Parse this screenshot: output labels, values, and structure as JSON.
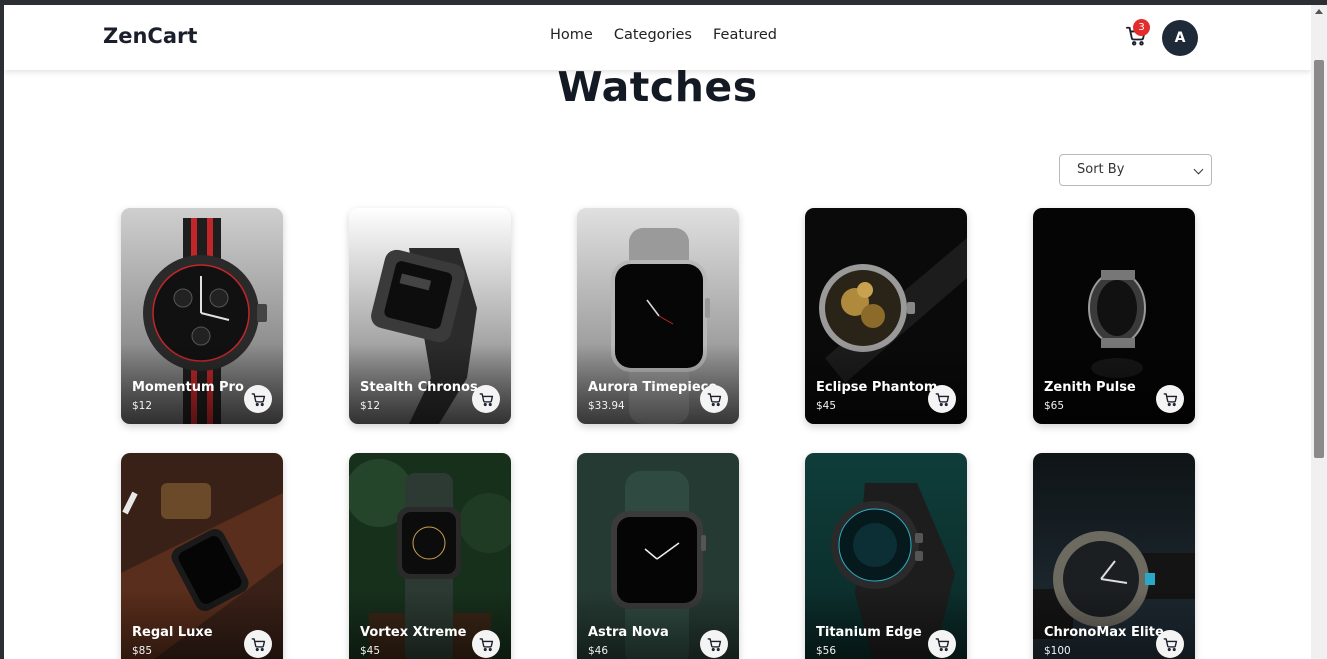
{
  "navbar": {
    "brand": "ZenCart",
    "links": [
      "Home",
      "Categories",
      "Featured"
    ],
    "cart_count": "3",
    "avatar_initial": "A"
  },
  "page": {
    "title": "Watches",
    "sort_label": "Sort By"
  },
  "products": [
    {
      "name": "Momentum Pro",
      "price": "$12"
    },
    {
      "name": "Stealth Chronos",
      "price": "$12"
    },
    {
      "name": "Aurora Timepiece",
      "price": "$33.94"
    },
    {
      "name": "Eclipse Phantom",
      "price": "$45"
    },
    {
      "name": "Zenith Pulse",
      "price": "$65"
    },
    {
      "name": "Regal Luxe",
      "price": "$85"
    },
    {
      "name": "Vortex Xtreme",
      "price": "$45"
    },
    {
      "name": "Astra Nova",
      "price": "$46"
    },
    {
      "name": "Titanium Edge",
      "price": "$56"
    },
    {
      "name": "ChronoMax Elite",
      "price": "$100"
    }
  ],
  "icons": {
    "cart": "cart-icon",
    "chevron": "chevron-down-icon"
  },
  "colors": {
    "badge": "#e32d2d",
    "avatar": "#1f2a38",
    "title": "#141a24"
  }
}
